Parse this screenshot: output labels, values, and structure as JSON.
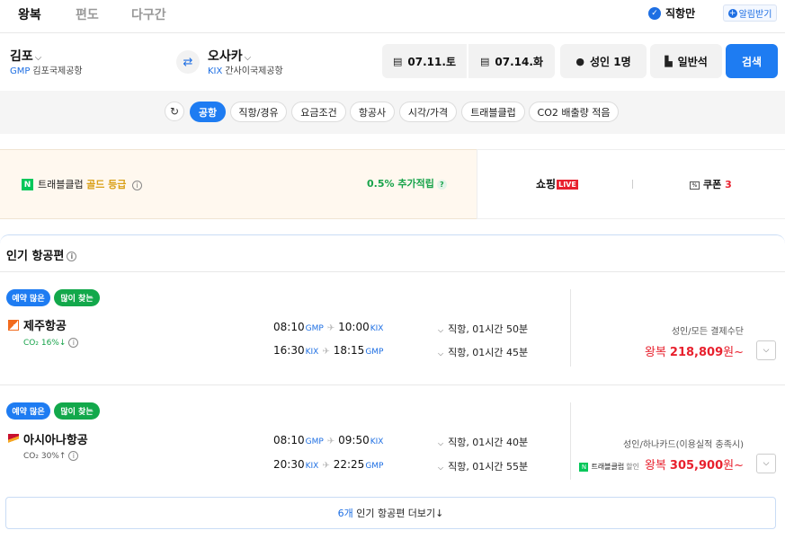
{
  "trip_tabs": [
    {
      "label": "왕복",
      "active": true
    },
    {
      "label": "편도",
      "active": false
    },
    {
      "label": "다구간",
      "active": false
    }
  ],
  "direct_only": {
    "label": "직항만",
    "checked": true
  },
  "alarm": {
    "label": "알림받기"
  },
  "search": {
    "origin": {
      "city": "김포",
      "code": "GMP",
      "airport": "김포국제공항"
    },
    "destination": {
      "city": "오사카",
      "code": "KIX",
      "airport": "간사이국제공항"
    },
    "depart_date": "07.11.토",
    "return_date": "07.14.화",
    "passengers": "성인 1명",
    "cabin": "일반석",
    "search_label": "검색"
  },
  "filters": [
    {
      "label": "공항",
      "active": true
    },
    {
      "label": "직항/경유",
      "active": false
    },
    {
      "label": "요금조건",
      "active": false
    },
    {
      "label": "항공사",
      "active": false
    },
    {
      "label": "시각/가격",
      "active": false
    },
    {
      "label": "트래블클럽",
      "active": false
    },
    {
      "label": "CO2 배출량 적음",
      "active": false
    }
  ],
  "promo": {
    "n_logo": "N",
    "club_prefix": "트래블클럽",
    "club_grade": "골드 등급",
    "extra_points": "0.5% 추가적립",
    "shopping": "쇼핑",
    "live": "LIVE",
    "coupon_label": "쿠폰",
    "coupon_count": "3"
  },
  "popular": {
    "title": "인기 항공편",
    "flights": [
      {
        "badges": [
          "예약 많은",
          "많이 찾는"
        ],
        "airline": "제주항공",
        "co2": "CO₂ 16%↓",
        "co2_good": true,
        "out": {
          "dep": "08:10",
          "dep_code": "GMP",
          "arr": "10:00",
          "arr_code": "KIX",
          "duration": "직항, 01시간 50분"
        },
        "ret": {
          "dep": "16:30",
          "dep_code": "KIX",
          "arr": "18:15",
          "arr_code": "GMP",
          "duration": "직항, 01시간 45분"
        },
        "payment": "성인/모든 결제수단",
        "price_label": "왕복",
        "price": "218,809",
        "price_suffix": "원~",
        "logo_color": "#f26b1d"
      },
      {
        "badges": [
          "예약 많은",
          "많이 찾는"
        ],
        "airline": "아시아나항공",
        "co2": "CO₂ 30%↑",
        "co2_good": false,
        "out": {
          "dep": "08:10",
          "dep_code": "GMP",
          "arr": "09:50",
          "arr_code": "KIX",
          "duration": "직항, 01시간 40분"
        },
        "ret": {
          "dep": "20:30",
          "dep_code": "KIX",
          "arr": "22:25",
          "arr_code": "GMP",
          "duration": "직항, 01시간 55분"
        },
        "payment": "성인/하나카드(이용실적 충족시)",
        "tc_label": "트래블클럽",
        "tc_discount": "할인",
        "price_label": "왕복",
        "price": "305,900",
        "price_suffix": "원~",
        "logo_color": "#c8102e"
      }
    ],
    "more_count": "6개",
    "more_text": "인기 항공편 더보기↓"
  }
}
